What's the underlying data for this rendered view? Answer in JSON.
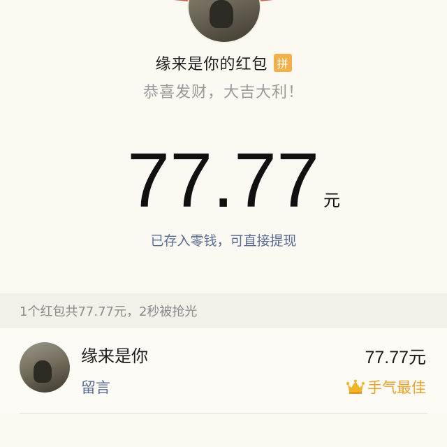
{
  "header": {
    "sender_name": "缘来是你的红包",
    "pin_badge": "拼",
    "blessing": "恭喜发财，大吉大利！"
  },
  "amount": {
    "value": "77.77",
    "unit": "元",
    "deposit_link": "已存入零钱，可直接提现"
  },
  "summary": {
    "text": "1个红包共77.77元，2秒被抢光"
  },
  "records": [
    {
      "name": "缘来是你",
      "comment": "留言",
      "amount": "77.77元",
      "best_luck": "手气最佳"
    }
  ],
  "colors": {
    "accent_red": "#d55a45",
    "link_blue": "#576b95",
    "best_luck_gold": "#e8a12e",
    "badge_orange": "#f2b04a"
  },
  "icons": {
    "badge": "pin-badge-icon",
    "crown": "crown-icon"
  }
}
